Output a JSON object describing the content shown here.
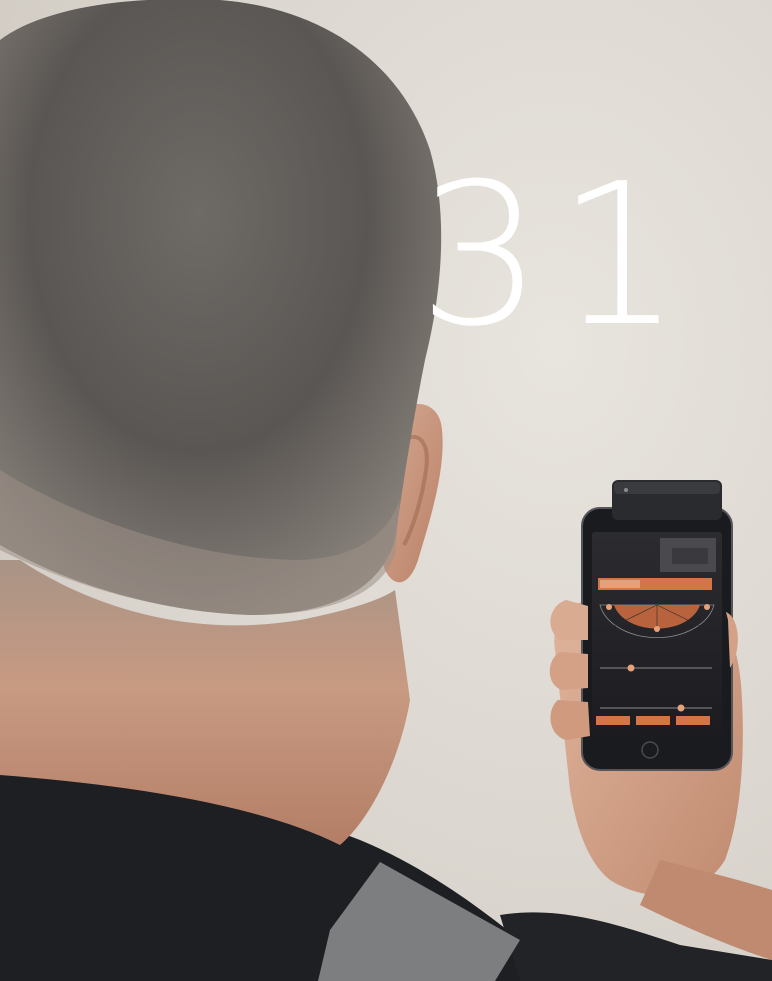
{
  "page": {
    "number": "31"
  },
  "phone_app": {
    "back_label": "",
    "title": "",
    "bottom_buttons": []
  },
  "colors": {
    "wall": "#d9d4cd",
    "skin": "#c9977c",
    "hair": "#5e5a56",
    "shirt": "#1e1f22",
    "shirt_stripe": "#7d7e80",
    "app_accent": "#d2764a",
    "phone_body": "#1a1b1e",
    "page_number": "#ffffff"
  }
}
